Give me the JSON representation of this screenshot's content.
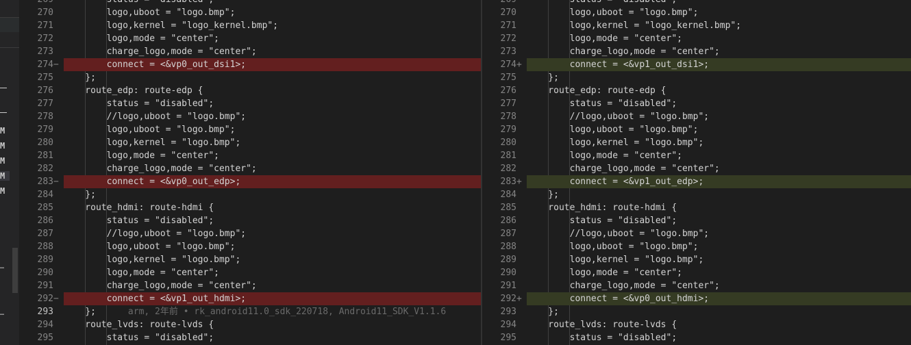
{
  "left_pane": {
    "lines": [
      {
        "n": "269",
        "text": "        status = \"disabled\";",
        "type": ""
      },
      {
        "n": "270",
        "text": "        logo,uboot = \"logo.bmp\";",
        "type": ""
      },
      {
        "n": "271",
        "text": "        logo,kernel = \"logo_kernel.bmp\";",
        "type": ""
      },
      {
        "n": "272",
        "text": "        logo,mode = \"center\";",
        "type": ""
      },
      {
        "n": "273",
        "text": "        charge_logo,mode = \"center\";",
        "type": ""
      },
      {
        "n": "274",
        "text": "        connect = <&vp0_out_dsi1>;",
        "type": "del",
        "marker": "−"
      },
      {
        "n": "275",
        "text": "    };",
        "type": ""
      },
      {
        "n": "276",
        "text": "    route_edp: route-edp {",
        "type": ""
      },
      {
        "n": "277",
        "text": "        status = \"disabled\";",
        "type": ""
      },
      {
        "n": "278",
        "text": "        //logo,uboot = \"logo.bmp\";",
        "type": ""
      },
      {
        "n": "279",
        "text": "        logo,uboot = \"logo.bmp\";",
        "type": ""
      },
      {
        "n": "280",
        "text": "        logo,kernel = \"logo.bmp\";",
        "type": ""
      },
      {
        "n": "281",
        "text": "        logo,mode = \"center\";",
        "type": ""
      },
      {
        "n": "282",
        "text": "        charge_logo,mode = \"center\";",
        "type": ""
      },
      {
        "n": "283",
        "text": "        connect = <&vp0_out_edp>;",
        "type": "del",
        "marker": "−"
      },
      {
        "n": "284",
        "text": "    };",
        "type": ""
      },
      {
        "n": "285",
        "text": "    route_hdmi: route-hdmi {",
        "type": ""
      },
      {
        "n": "286",
        "text": "        status = \"disabled\";",
        "type": ""
      },
      {
        "n": "287",
        "text": "        //logo,uboot = \"logo.bmp\";",
        "type": ""
      },
      {
        "n": "288",
        "text": "        logo,uboot = \"logo.bmp\";",
        "type": ""
      },
      {
        "n": "289",
        "text": "        logo,kernel = \"logo.bmp\";",
        "type": ""
      },
      {
        "n": "290",
        "text": "        logo,mode = \"center\";",
        "type": ""
      },
      {
        "n": "291",
        "text": "        charge_logo,mode = \"center\";",
        "type": ""
      },
      {
        "n": "292",
        "text": "        connect = <&vp1_out_hdmi>;",
        "type": "del",
        "marker": "−"
      },
      {
        "n": "293",
        "text": "    };",
        "type": "cur",
        "blame": "      arm, 2年前 • rk_android11.0_sdk_220718, Android11_SDK_V1.1.6"
      },
      {
        "n": "294",
        "text": "    route_lvds: route-lvds {",
        "type": ""
      },
      {
        "n": "295",
        "text": "        status = \"disabled\";",
        "type": ""
      }
    ]
  },
  "right_pane": {
    "lines": [
      {
        "n": "269",
        "text": "        status = \"disabled\";",
        "type": ""
      },
      {
        "n": "270",
        "text": "        logo,uboot = \"logo.bmp\";",
        "type": ""
      },
      {
        "n": "271",
        "text": "        logo,kernel = \"logo_kernel.bmp\";",
        "type": ""
      },
      {
        "n": "272",
        "text": "        logo,mode = \"center\";",
        "type": ""
      },
      {
        "n": "273",
        "text": "        charge_logo,mode = \"center\";",
        "type": ""
      },
      {
        "n": "274",
        "text": "        connect = <&vp1_out_dsi1>;",
        "type": "add",
        "marker": "+"
      },
      {
        "n": "275",
        "text": "    };",
        "type": ""
      },
      {
        "n": "276",
        "text": "    route_edp: route-edp {",
        "type": ""
      },
      {
        "n": "277",
        "text": "        status = \"disabled\";",
        "type": ""
      },
      {
        "n": "278",
        "text": "        //logo,uboot = \"logo.bmp\";",
        "type": ""
      },
      {
        "n": "279",
        "text": "        logo,uboot = \"logo.bmp\";",
        "type": ""
      },
      {
        "n": "280",
        "text": "        logo,kernel = \"logo.bmp\";",
        "type": ""
      },
      {
        "n": "281",
        "text": "        logo,mode = \"center\";",
        "type": ""
      },
      {
        "n": "282",
        "text": "        charge_logo,mode = \"center\";",
        "type": ""
      },
      {
        "n": "283",
        "text": "        connect = <&vp1_out_edp>;",
        "type": "add",
        "marker": "+"
      },
      {
        "n": "284",
        "text": "    };",
        "type": ""
      },
      {
        "n": "285",
        "text": "    route_hdmi: route-hdmi {",
        "type": ""
      },
      {
        "n": "286",
        "text": "        status = \"disabled\";",
        "type": ""
      },
      {
        "n": "287",
        "text": "        //logo,uboot = \"logo.bmp\";",
        "type": ""
      },
      {
        "n": "288",
        "text": "        logo,uboot = \"logo.bmp\";",
        "type": ""
      },
      {
        "n": "289",
        "text": "        logo,kernel = \"logo.bmp\";",
        "type": ""
      },
      {
        "n": "290",
        "text": "        logo,mode = \"center\";",
        "type": ""
      },
      {
        "n": "291",
        "text": "        charge_logo,mode = \"center\";",
        "type": ""
      },
      {
        "n": "292",
        "text": "        connect = <&vp0_out_hdmi>;",
        "type": "add",
        "marker": "+"
      },
      {
        "n": "293",
        "text": "    };",
        "type": ""
      },
      {
        "n": "294",
        "text": "    route_lvds: route-lvds {",
        "type": ""
      },
      {
        "n": "295",
        "text": "        status = \"disabled\";",
        "type": ""
      }
    ]
  },
  "sidebar": {
    "badges": [
      "M",
      "M",
      "M",
      "M",
      "M"
    ],
    "ellipses": [
      "…",
      "…"
    ]
  },
  "colors": {
    "deleted_line": "#631f1f",
    "added_line": "#353b23",
    "editor_bg": "#1e1e1e"
  }
}
